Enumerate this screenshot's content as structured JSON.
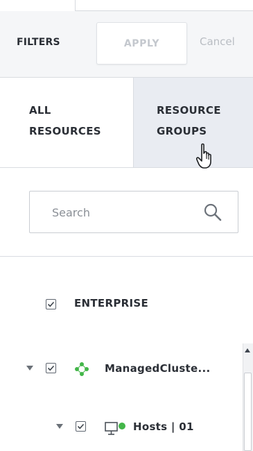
{
  "header": {
    "filters_title": "FILTERS",
    "apply_label": "APPLY",
    "cancel_label": "Cancel"
  },
  "tabs": [
    {
      "line1": "ALL",
      "line2": "RESOURCES",
      "active": false
    },
    {
      "line1": "RESOURCE",
      "line2": "GROUPS",
      "active": true
    }
  ],
  "search": {
    "placeholder": "Search",
    "value": ""
  },
  "tree": {
    "root": {
      "label": "ENTERPRISE",
      "checked": true
    },
    "cluster": {
      "label": "ManagedCluste...",
      "checked": true,
      "expanded": true
    },
    "hosts": {
      "label": "Hosts | 01",
      "checked": true,
      "expanded": true
    }
  },
  "icons": {
    "search": "search-icon",
    "cluster": "cluster-icon",
    "host": "host-monitor-icon",
    "cursor": "hand-pointer-icon"
  },
  "colors": {
    "cluster_green": "#43b649",
    "host_green": "#43b649",
    "active_tab_bg": "#e9ecf2"
  }
}
